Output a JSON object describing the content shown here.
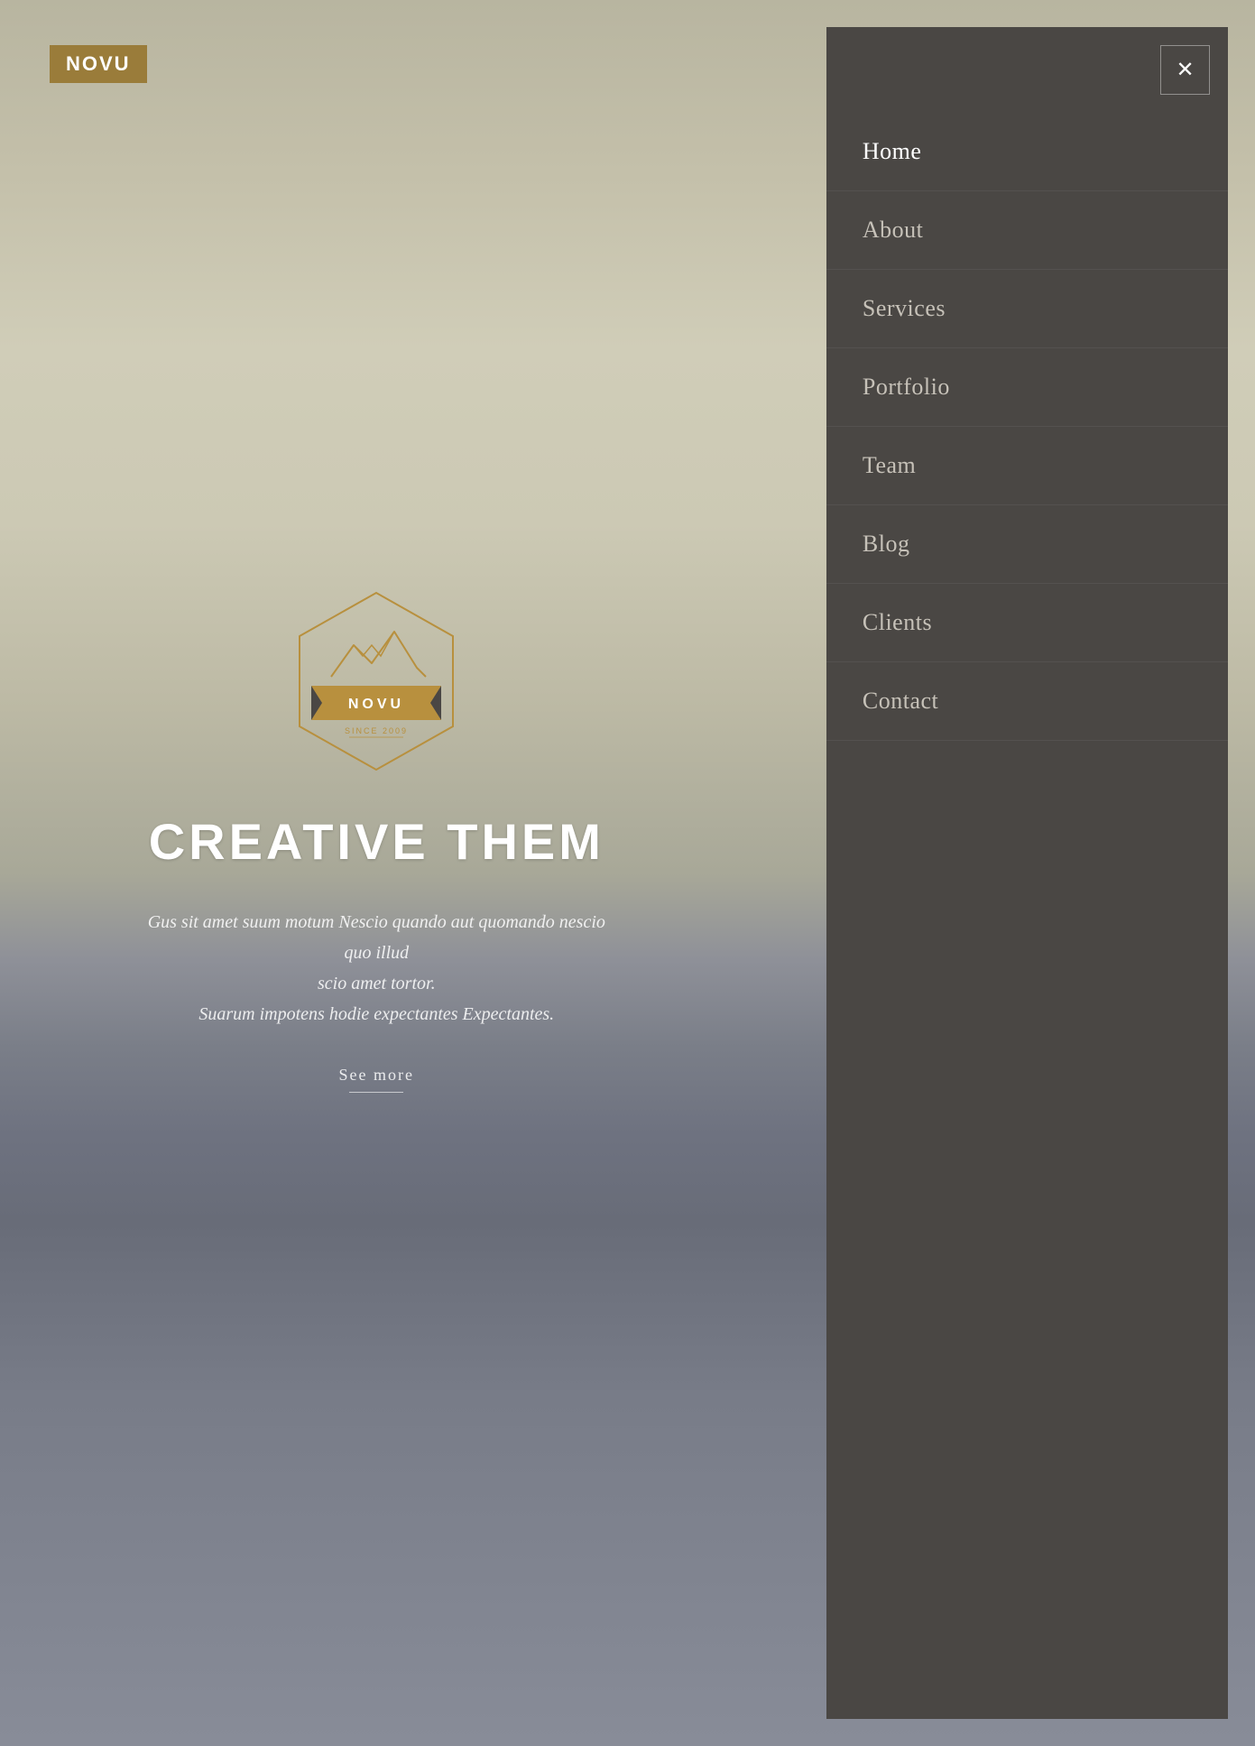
{
  "brand": {
    "name": "NOVU",
    "logo_text": "NOVU",
    "since": "SINCE 2009"
  },
  "hero": {
    "title": "CREATIVE THEM",
    "subtitle_line1": "Gus sit amet suum motum Nescio quando aut quom",
    "subtitle_line2": "ando nescio quo illud",
    "subtitle_line3": "scio amet tortor.",
    "subtitle_line4": "Suarum impotens hodie expectantes Exp",
    "subtitle_line5": "ectantes.",
    "cta_label": "See more"
  },
  "nav": {
    "close_icon": "✕",
    "items": [
      {
        "label": "Home",
        "active": true
      },
      {
        "label": "About",
        "active": false
      },
      {
        "label": "Services",
        "active": false
      },
      {
        "label": "Portfolio",
        "active": false
      },
      {
        "label": "Team",
        "active": false
      },
      {
        "label": "Blog",
        "active": false
      },
      {
        "label": "Clients",
        "active": false
      },
      {
        "label": "Contact",
        "active": false
      }
    ]
  },
  "colors": {
    "brand_gold": "#9a7c3a",
    "sidebar_bg": "#4a4744",
    "nav_text": "rgba(220,215,205,0.85)"
  }
}
